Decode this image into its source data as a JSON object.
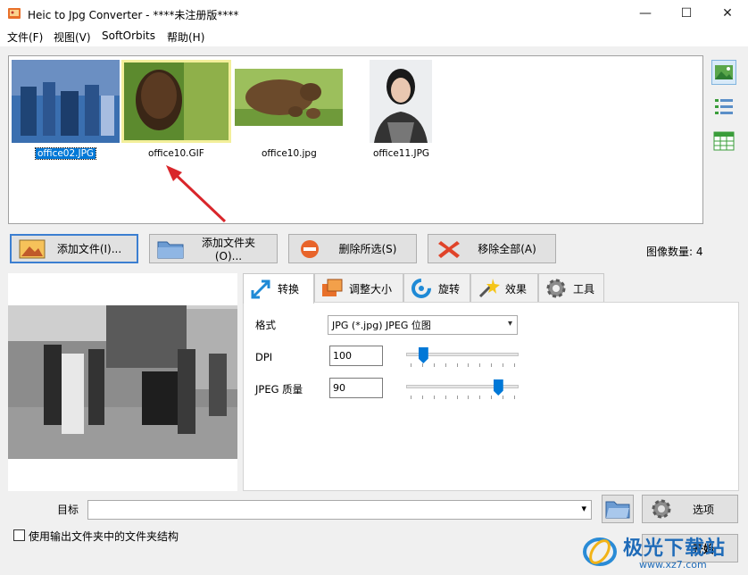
{
  "window": {
    "title": "Heic to Jpg Converter - ****未注册版****",
    "minimize": "—",
    "maximize": "☐",
    "close": "✕"
  },
  "menu": [
    "文件(F)",
    "视图(V)",
    "SoftOrbits",
    "帮助(H)"
  ],
  "thumbnails": [
    {
      "label": "office02.JPG",
      "selected": true
    },
    {
      "label": "office10.GIF",
      "selected": false
    },
    {
      "label": "office10.jpg",
      "selected": false
    },
    {
      "label": "office11.JPG",
      "selected": false
    }
  ],
  "toolbar": {
    "add_file": "添加文件(I)...",
    "add_folder": "添加文件夹(O)...",
    "remove_selected": "删除所选(S)",
    "remove_all": "移除全部(A)",
    "image_count": "图像数量: 4"
  },
  "tabs": [
    "转换",
    "调整大小",
    "旋转",
    "效果",
    "工具"
  ],
  "convert": {
    "format_label": "格式",
    "format_value": "JPG (*.jpg) JPEG 位图",
    "dpi_label": "DPI",
    "dpi_value": "100",
    "quality_label": "JPEG 质量",
    "quality_value": "90",
    "dpi_slider": 0.12,
    "quality_slider": 0.85
  },
  "bottom": {
    "target_label": "目标",
    "target_value": "",
    "options": "选项",
    "use_structure": "使用输出文件夹中的文件夹结构",
    "start": "开始"
  },
  "watermark": {
    "text": "极光下载站",
    "url": "www.xz7.com"
  },
  "colors": {
    "accent": "#0078d7",
    "selection": "#0078d7",
    "arrow": "#d9262b"
  }
}
